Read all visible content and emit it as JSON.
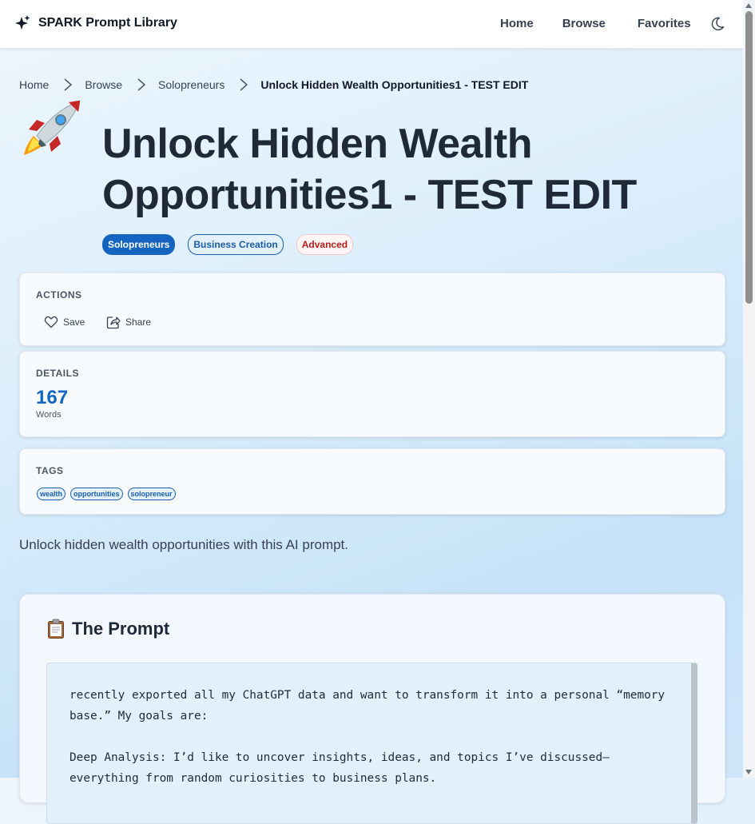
{
  "nav": {
    "brand": "SPARK Prompt Library",
    "links": [
      "Home",
      "Browse",
      "Favorites"
    ],
    "theme_toggle": "moon-icon"
  },
  "breadcrumb": [
    "Home",
    "Browse",
    "Solopreneurs",
    "Unlock Hidden Wealth Opportunities1 - TEST EDIT"
  ],
  "page": {
    "title_line1": "Unlock Hidden Wealth",
    "title_line2": "Opportunities1 - TEST EDIT",
    "emoji": "rocket",
    "chips": {
      "category": "Solopreneurs",
      "subcategory": "Business Creation",
      "level": "Advanced"
    },
    "description": "Unlock hidden wealth opportunities with this AI prompt."
  },
  "actions": {
    "label": "ACTIONS",
    "save": "Save",
    "share": "Share"
  },
  "details": {
    "label": "DETAILS",
    "words_value": "167",
    "words_label": "Words"
  },
  "tags": {
    "label": "TAGS",
    "items": [
      "wealth",
      "opportunities",
      "solopreneur"
    ]
  },
  "prompt": {
    "heading": "The Prompt",
    "lines": [
      "recently exported all my ChatGPT data and want to transform it into a personal “memory",
      "base.” My goals are:",
      "",
      "Deep Analysis: I’d like to uncover insights, ideas, and topics I’ve discussed—",
      "everything from random curiosities to business plans."
    ]
  },
  "colors": {
    "accent": "#1565c0",
    "level_red": "#b91c1c",
    "background": "#dbeefb"
  }
}
